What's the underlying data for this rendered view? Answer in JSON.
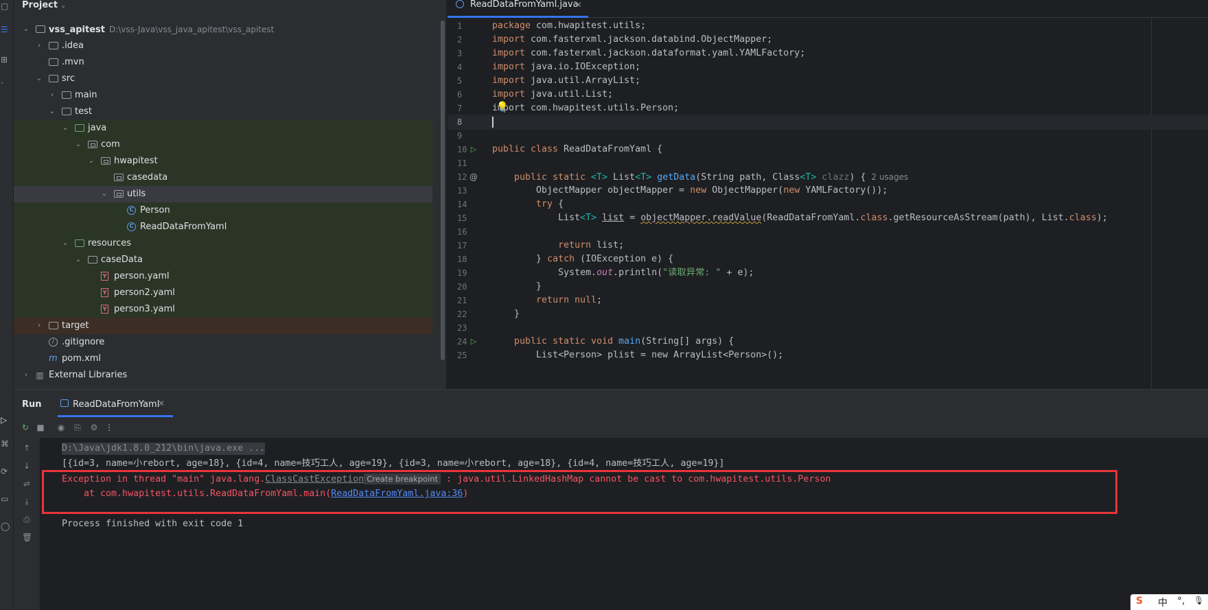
{
  "project": {
    "header": "Project",
    "tree": [
      {
        "label": "vss_apitest",
        "path": "D:\\vss-Java\\vss_java_apitest\\vss_apitest",
        "depth": 0,
        "expanded": true,
        "icon": "folder-icon",
        "bold": true
      },
      {
        "label": ".idea",
        "depth": 1,
        "expanded": false,
        "icon": "folder-icon"
      },
      {
        "label": ".mvn",
        "depth": 1,
        "icon": "folder-icon"
      },
      {
        "label": "src",
        "depth": 1,
        "expanded": true,
        "icon": "folder-icon"
      },
      {
        "label": "main",
        "depth": 2,
        "expanded": false,
        "icon": "folder-icon"
      },
      {
        "label": "test",
        "depth": 2,
        "expanded": true,
        "icon": "folder-icon"
      },
      {
        "label": "java",
        "depth": 3,
        "expanded": true,
        "icon": "source-folder-icon"
      },
      {
        "label": "com",
        "depth": 4,
        "expanded": true,
        "icon": "package-icon"
      },
      {
        "label": "hwapitest",
        "depth": 5,
        "expanded": true,
        "icon": "package-icon"
      },
      {
        "label": "casedata",
        "depth": 6,
        "icon": "package-icon"
      },
      {
        "label": "utils",
        "depth": 6,
        "expanded": true,
        "icon": "package-icon"
      },
      {
        "label": "Person",
        "depth": 7,
        "icon": "class-icon"
      },
      {
        "label": "ReadDataFromYaml",
        "depth": 7,
        "icon": "class-icon"
      },
      {
        "label": "resources",
        "depth": 3,
        "expanded": true,
        "icon": "resources-folder-icon"
      },
      {
        "label": "caseData",
        "depth": 4,
        "expanded": true,
        "icon": "folder-icon"
      },
      {
        "label": "person.yaml",
        "depth": 5,
        "icon": "yaml-icon"
      },
      {
        "label": "person2.yaml",
        "depth": 5,
        "icon": "yaml-icon"
      },
      {
        "label": "person3.yaml",
        "depth": 5,
        "icon": "yaml-icon"
      },
      {
        "label": "target",
        "depth": 1,
        "expanded": false,
        "icon": "folder-icon"
      },
      {
        "label": ".gitignore",
        "depth": 1,
        "icon": "ignore-file-icon"
      },
      {
        "label": "pom.xml",
        "depth": 1,
        "icon": "maven-icon"
      },
      {
        "label": "External Libraries",
        "depth": 0,
        "expanded": false,
        "icon": "library-icon"
      }
    ]
  },
  "editor": {
    "tab_label": "ReadDataFromYaml.java",
    "current_line": 8,
    "lines": [
      {
        "n": "1"
      },
      {
        "n": "2"
      },
      {
        "n": "3"
      },
      {
        "n": "4"
      },
      {
        "n": "5"
      },
      {
        "n": "6"
      },
      {
        "n": "7"
      },
      {
        "n": "8"
      },
      {
        "n": "9"
      },
      {
        "n": "10"
      },
      {
        "n": "11"
      },
      {
        "n": "12"
      },
      {
        "n": "13"
      },
      {
        "n": "14"
      },
      {
        "n": "15"
      },
      {
        "n": "16"
      },
      {
        "n": "17"
      },
      {
        "n": "18"
      },
      {
        "n": "19"
      },
      {
        "n": "20"
      },
      {
        "n": "21"
      },
      {
        "n": "22"
      },
      {
        "n": "23"
      },
      {
        "n": "24"
      },
      {
        "n": "25"
      }
    ],
    "code": {
      "l1_kw": "package",
      "l1_rest": " com.hwapitest.utils;",
      "l2_kw": "import",
      "l2_rest": " com.fasterxml.jackson.databind.ObjectMapper;",
      "l3_kw": "import",
      "l3_rest": " com.fasterxml.jackson.dataformat.yaml.YAMLFactory;",
      "l4_kw": "import",
      "l4_rest": " java.io.IOException;",
      "l5_kw": "import",
      "l5_rest": " java.util.ArrayList;",
      "l6_kw": "import",
      "l6_rest": " java.util.List;",
      "l7_text": "import com.hwapitest.utils.Person;",
      "l10_kw": "public class",
      "l10_rest": " ReadDataFromYaml {",
      "l12_kw1": "public static",
      "l12_t1": "<T>",
      "l12_a": " List",
      "l12_t2": "<T>",
      "l12_fn": "getData",
      "l12_b": "(String path, Class",
      "l12_t3": "<T>",
      "l12_c": " clazz",
      "l12_d": ") {",
      "l12_hint": "2 usages",
      "l13_a": "ObjectMapper objectMapper = ",
      "l13_kw": "new",
      "l13_b": " ObjectMapper(",
      "l13_kw2": "new",
      "l13_c": " YAMLFactory());",
      "l14_kw": "try",
      "l14_rest": " {",
      "l15_a": "List",
      "l15_t": "<T>",
      "l15_var": "list",
      "l15_b": " = ",
      "l15_call": "objectMapper.readValue",
      "l15_c": "(ReadDataFromYaml.",
      "l15_kw": "class",
      "l15_d": ".getResourceAsStream(path), List.",
      "l15_kw2": "class",
      "l15_e": ");",
      "l17_kw": "return",
      "l17_rest": " list;",
      "l18_a": "} ",
      "l18_kw": "catch",
      "l18_rest": " (IOException e) {",
      "l19_a": "System.",
      "l19_it": "out",
      "l19_b": ".println(",
      "l19_st": "\"读取异常: \"",
      "l19_c": " + e);",
      "l20_text": "}",
      "l21_kw": "return",
      "l21_sp": " ",
      "l21_kw2": "null",
      "l21_rest": ";",
      "l22_text": "}",
      "l24_kw": "public static void",
      "l24_fn": "main",
      "l24_rest": "(String[] args) {",
      "l25_text": "List<Person> plist = new ArrayList<Person>();"
    }
  },
  "run": {
    "title": "Run",
    "tab_label": "ReadDataFromYaml",
    "console": {
      "cmd": "D:\\Java\\jdk1.8.0_212\\bin\\java.exe ...",
      "output": "[{id=3, name=小rebort, age=18}, {id=4, name=技巧工人, age=19}, {id=3, name=小rebort, age=18}, {id=4, name=技巧工人, age=19}]",
      "err_prefix": "Exception in thread \"main\" java.lang.",
      "err_class": "ClassCastException",
      "tooltip": "Create breakpoint",
      "err_msg": " : java.util.LinkedHashMap cannot be cast to com.hwapitest.utils.Person",
      "at_prefix": "    at com.hwapitest.utils.ReadDataFromYaml.main(",
      "at_link": "ReadDataFromYaml.java:36",
      "at_suffix": ")",
      "exit": "Process finished with exit code 1"
    }
  },
  "ime": {
    "logo": "S",
    "lang": "中",
    "punct": "°,",
    "mic": "🎙"
  },
  "colors": {
    "accent": "#3574f0",
    "error": "#f75464",
    "highlight_box": "#e8353b"
  }
}
